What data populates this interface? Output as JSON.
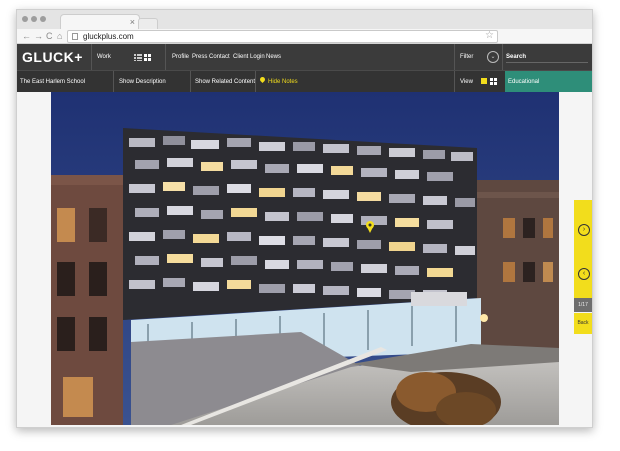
{
  "browser": {
    "tab_title": "",
    "tab_close": "×",
    "nav_back": "←",
    "nav_forward": "→",
    "nav_reload": "C",
    "nav_home": "⌂",
    "url": "gluckplus.com",
    "bookmark_icon": "star-icon"
  },
  "site": {
    "logo": "GLUCK+",
    "work_label": "Work",
    "menu": [
      "Profile",
      "Press",
      "Contact",
      "Client Login",
      "News"
    ],
    "filter_label": "Filter",
    "filter_icon": "⌄",
    "search_label": "Search"
  },
  "subnav": {
    "project": "The East Harlem School",
    "show_description": "Show Description",
    "show_related": "Show Related Content",
    "hide_notes": "Hide Notes",
    "view_label": "View",
    "category": "Educational"
  },
  "slideshow": {
    "next_icon": "›",
    "prev_icon": "‹",
    "counter": "1/17",
    "back_label": "Back"
  },
  "colors": {
    "accent_yellow": "#f2dd1c",
    "educational_green": "#2e8e79",
    "nav_dark": "#3b3b3b",
    "sky_blue": "#243a79"
  }
}
